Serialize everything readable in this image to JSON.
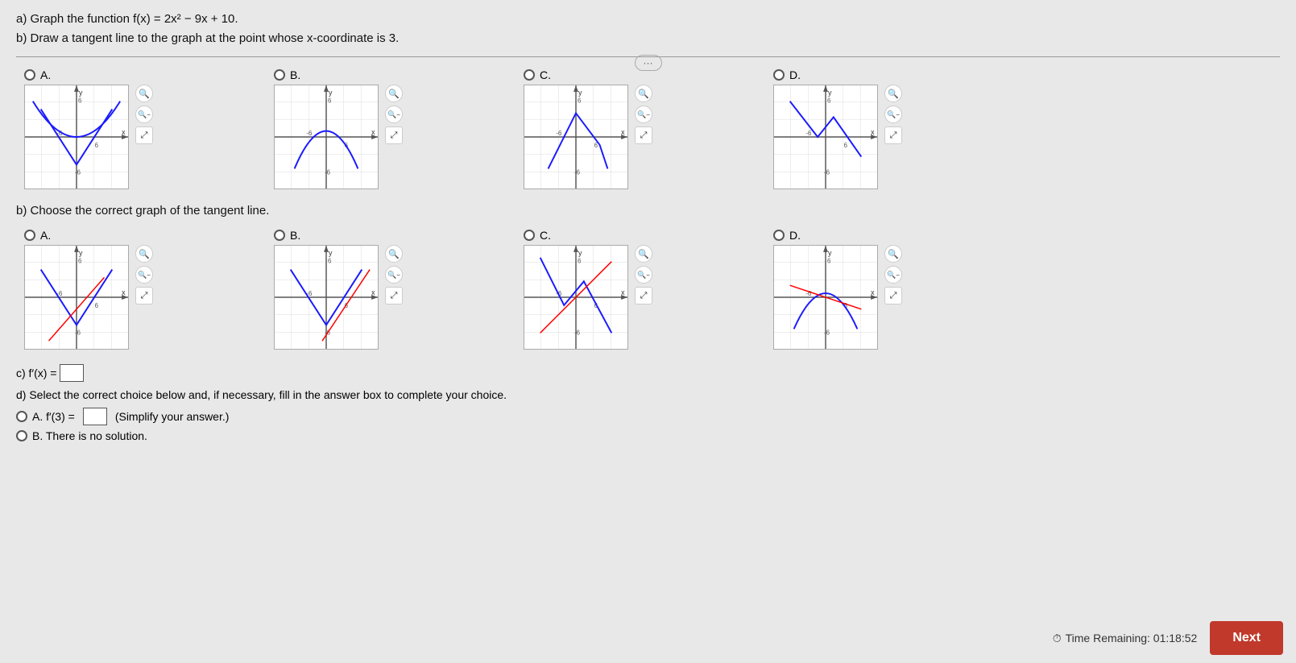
{
  "problem": {
    "line1": "a) Graph the function f(x) = 2x² − 9x + 10.",
    "line2": "b) Draw a tangent line to the graph at the point whose x-coordinate is 3.",
    "part_b_title": "b) Choose the correct graph of the tangent line.",
    "part_c_label": "c) f′(x) =",
    "part_d_label": "d) Select the correct choice below and, if necessary, fill in the answer box to complete your choice.",
    "part_d_optA": "A.  f′(3) =",
    "part_d_optA_suffix": "(Simplify your answer.)",
    "part_d_optB": "B.  There is no solution.",
    "time_label": "Time Remaining: 01:18:52",
    "next_label": "Next",
    "more_label": "···"
  },
  "partA_choices": [
    {
      "id": "a_A",
      "label": "A.",
      "selected": false
    },
    {
      "id": "a_B",
      "label": "B.",
      "selected": false
    },
    {
      "id": "a_C",
      "label": "C.",
      "selected": false
    },
    {
      "id": "a_D",
      "label": "D.",
      "selected": false
    }
  ],
  "partB_choices": [
    {
      "id": "b_A",
      "label": "A.",
      "selected": false
    },
    {
      "id": "b_B",
      "label": "B.",
      "selected": false
    },
    {
      "id": "b_C",
      "label": "C.",
      "selected": false
    },
    {
      "id": "b_D",
      "label": "D.",
      "selected": false
    }
  ],
  "icons": {
    "zoom_in": "🔍",
    "zoom_minus": "🔍",
    "expand": "⤢",
    "clock": "⏱"
  }
}
